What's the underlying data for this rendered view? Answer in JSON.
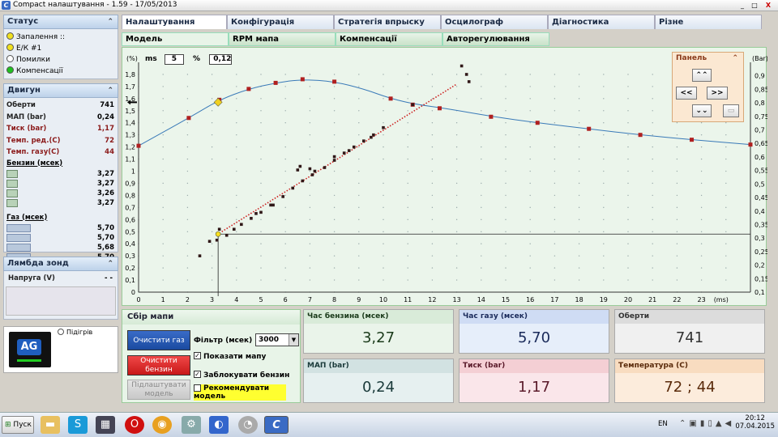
{
  "window": {
    "title": "Compact налаштування - 1.59 - 17/05/2013",
    "minimize": "_",
    "maximize": "□",
    "close": "X"
  },
  "status": {
    "title": "Статус",
    "items": [
      {
        "label": "Запалення ::",
        "color": "#f0e020"
      },
      {
        "label": "Е/К #1",
        "color": "#f0e020"
      },
      {
        "label": "Помилки",
        "color": "#ffffff"
      },
      {
        "label": "Компенсації",
        "color": "#20c020"
      }
    ]
  },
  "engine": {
    "title": "Двигун",
    "rows": [
      {
        "key": "Оберти",
        "value": "741",
        "red": false
      },
      {
        "key": "МАП (bar)",
        "value": "0,24",
        "red": false
      },
      {
        "key": "Тиск (bar)",
        "value": "1,17",
        "red": true
      },
      {
        "key": "Темп. ред.(С)",
        "value": "72",
        "red": true
      },
      {
        "key": "Темп. газу(С)",
        "value": "44",
        "red": true
      }
    ],
    "petrol_title": "Бензин (мсек)",
    "petrol": [
      "3,27",
      "3,27",
      "3,26",
      "3,27"
    ],
    "gas_title": "Газ (мсек)",
    "gas": [
      "5,70",
      "5,70",
      "5,68",
      "5,70"
    ]
  },
  "lambda": {
    "title": "Лямбда зонд",
    "voltage_label": "Напруга (V)",
    "voltage_value": "- -"
  },
  "logo": {
    "text": "AG",
    "radio_label": "Підігрів"
  },
  "tabs_main": [
    "Налаштування",
    "Конфігурація",
    "Стратегія впрыску",
    "Осцилограф",
    "Діагностика",
    "Різне"
  ],
  "tabs_sub": [
    "Модель",
    "RPM мапа",
    "Компенсації",
    "Авторегулювання"
  ],
  "chart_controls": {
    "ms_label": "ms",
    "ms_value": "5",
    "pct_label": "%",
    "pct_value": "0,12"
  },
  "panel": {
    "title": "Панель",
    "btn_up": "⌃⌃",
    "btn_left": "<<",
    "btn_right": ">>",
    "btn_down": "⌄⌄"
  },
  "chart_data": {
    "type": "scatter",
    "xlabel": "(ms)",
    "ylabel_left": "(%)",
    "ylabel_right": "(Bar)",
    "xlim": [
      0,
      25
    ],
    "ylim": [
      0,
      1.9
    ],
    "ylim_right": [
      0.1,
      0.95
    ],
    "x_ticks": [
      "0",
      "1",
      "2",
      "3",
      "4",
      "5",
      "6",
      "7",
      "8",
      "9",
      "10",
      "11",
      "12",
      "13",
      "14",
      "15",
      "16",
      "17",
      "18",
      "19",
      "20",
      "21",
      "22",
      "23"
    ],
    "y_ticks": [
      "0",
      "0,1",
      "0,2",
      "0,3",
      "0,4",
      "0,5",
      "0,6",
      "0,7",
      "0,8",
      "0,9",
      "1",
      "1,1",
      "1,2",
      "1,3",
      "1,4",
      "1,5",
      "1,6",
      "1,7",
      "1,8"
    ],
    "y_right_ticks": [
      "0,1",
      "0,15",
      "0,2",
      "0,25",
      "0,3",
      "0,35",
      "0,4",
      "0,45",
      "0,5",
      "0,55",
      "0,6",
      "0,65",
      "0,7",
      "0,75",
      "0,8",
      "0,85",
      "0,9"
    ],
    "grid": true,
    "curve_points": [
      [
        0,
        1.21
      ],
      [
        2.05,
        1.44
      ],
      [
        3.3,
        1.59
      ],
      [
        4.5,
        1.68
      ],
      [
        5.6,
        1.73
      ],
      [
        6.7,
        1.76
      ],
      [
        8,
        1.74
      ],
      [
        9.2,
        1.68
      ],
      [
        10.3,
        1.6
      ],
      [
        11.4,
        1.55
      ],
      [
        12.5,
        1.52
      ],
      [
        14.5,
        1.45
      ],
      [
        16.3,
        1.4
      ],
      [
        18.4,
        1.35
      ],
      [
        20.5,
        1.3
      ],
      [
        22.6,
        1.26
      ],
      [
        25,
        1.22
      ]
    ],
    "curve_markers": [
      [
        0,
        1.21
      ],
      [
        2.05,
        1.44
      ],
      [
        3.3,
        1.59
      ],
      [
        4.5,
        1.68
      ],
      [
        5.6,
        1.73
      ],
      [
        6.7,
        1.76
      ],
      [
        8,
        1.74
      ],
      [
        10.3,
        1.6
      ],
      [
        11.2,
        1.55
      ],
      [
        12.3,
        1.52
      ],
      [
        14.4,
        1.45
      ],
      [
        16.3,
        1.4
      ],
      [
        18.4,
        1.35
      ],
      [
        20.5,
        1.3
      ],
      [
        22.6,
        1.26
      ],
      [
        25,
        1.22
      ]
    ],
    "scatter": [
      [
        2.5,
        0.3
      ],
      [
        2.9,
        0.42
      ],
      [
        3.2,
        0.43
      ],
      [
        3.3,
        0.52
      ],
      [
        3.6,
        0.47
      ],
      [
        3.9,
        0.52
      ],
      [
        4.2,
        0.56
      ],
      [
        4.6,
        0.61
      ],
      [
        5,
        0.66
      ],
      [
        5.4,
        0.72
      ],
      [
        5.9,
        0.79
      ],
      [
        6.3,
        0.86
      ],
      [
        6.7,
        0.92
      ],
      [
        7.1,
        0.97
      ],
      [
        7.6,
        1.03
      ],
      [
        8,
        1.09
      ],
      [
        8.4,
        1.15
      ],
      [
        8.8,
        1.2
      ],
      [
        9.2,
        1.25
      ],
      [
        9.6,
        1.3
      ],
      [
        10,
        1.36
      ],
      [
        4.8,
        0.65
      ],
      [
        5.5,
        0.72
      ],
      [
        6.6,
        1.04
      ],
      [
        6.5,
        1.01
      ],
      [
        7,
        1.02
      ],
      [
        7.2,
        1.0
      ],
      [
        8,
        1.12
      ],
      [
        8.6,
        1.17
      ],
      [
        9.5,
        1.28
      ],
      [
        13.2,
        1.87
      ],
      [
        13.4,
        1.8
      ],
      [
        13.5,
        1.74
      ],
      [
        11.2,
        1.55
      ]
    ],
    "trend_line": [
      [
        3.4,
        0.5
      ],
      [
        13.0,
        1.72
      ]
    ],
    "ref_point": [
      3.25,
      0.48
    ],
    "current_marker": [
      3.25,
      1.57
    ],
    "hline": 0.48,
    "vline": 3.25
  },
  "map": {
    "title": "Сбір мапи",
    "clear_gas": "Очистити газ",
    "clear_petrol": "Очистити бензин",
    "adjust_model": "Підлаштувати модель",
    "filter_label": "Фільтр (мсек)",
    "filter_value": "3000",
    "show_map": "Показати мапу",
    "lock_petrol": "Заблокувати бензин",
    "recommend": "Рекомендувати модель"
  },
  "cards": [
    {
      "label": "Час бензина (мсек)",
      "value": "3,27",
      "head": "#d9ebd9",
      "body": "#eaf4ea",
      "text": "#1a3a1a"
    },
    {
      "label": "Час газу (мсек)",
      "value": "5,70",
      "head": "#cfdcf4",
      "body": "#e6eefa",
      "text": "#1a2a5a"
    },
    {
      "label": "Оберти",
      "value": "741",
      "head": "#dcdcdc",
      "body": "#f0f0f0",
      "text": "#333"
    },
    {
      "label": "МАП (bar)",
      "value": "0,24",
      "head": "#d2e2e2",
      "body": "#e6f0f0",
      "text": "#1a3a3a"
    },
    {
      "label": "Тиск (bar)",
      "value": "1,17",
      "head": "#f4cfd4",
      "body": "#fae6ea",
      "text": "#5a1a2a"
    },
    {
      "label": "Температура (С)",
      "value": "72 ; 44",
      "head": "#f8dcc0",
      "body": "#fcecdc",
      "text": "#5a2a0a"
    }
  ],
  "taskbar": {
    "start": "Пуск",
    "lang": "EN",
    "time": "20:12",
    "date": "07.04.2015"
  }
}
